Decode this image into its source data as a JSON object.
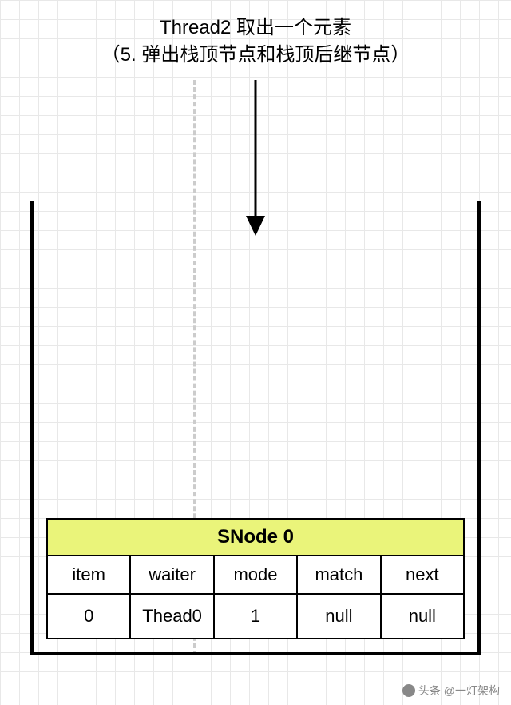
{
  "title": {
    "line1": "Thread2 取出一个元素",
    "line2": "（5. 弹出栈顶节点和栈顶后继节点）"
  },
  "node": {
    "name": "SNode 0",
    "labels": [
      "item",
      "waiter",
      "mode",
      "match",
      "next"
    ],
    "values": [
      "0",
      "Thead0",
      "1",
      "null",
      "null"
    ]
  },
  "watermark": "头条 @一灯架构"
}
